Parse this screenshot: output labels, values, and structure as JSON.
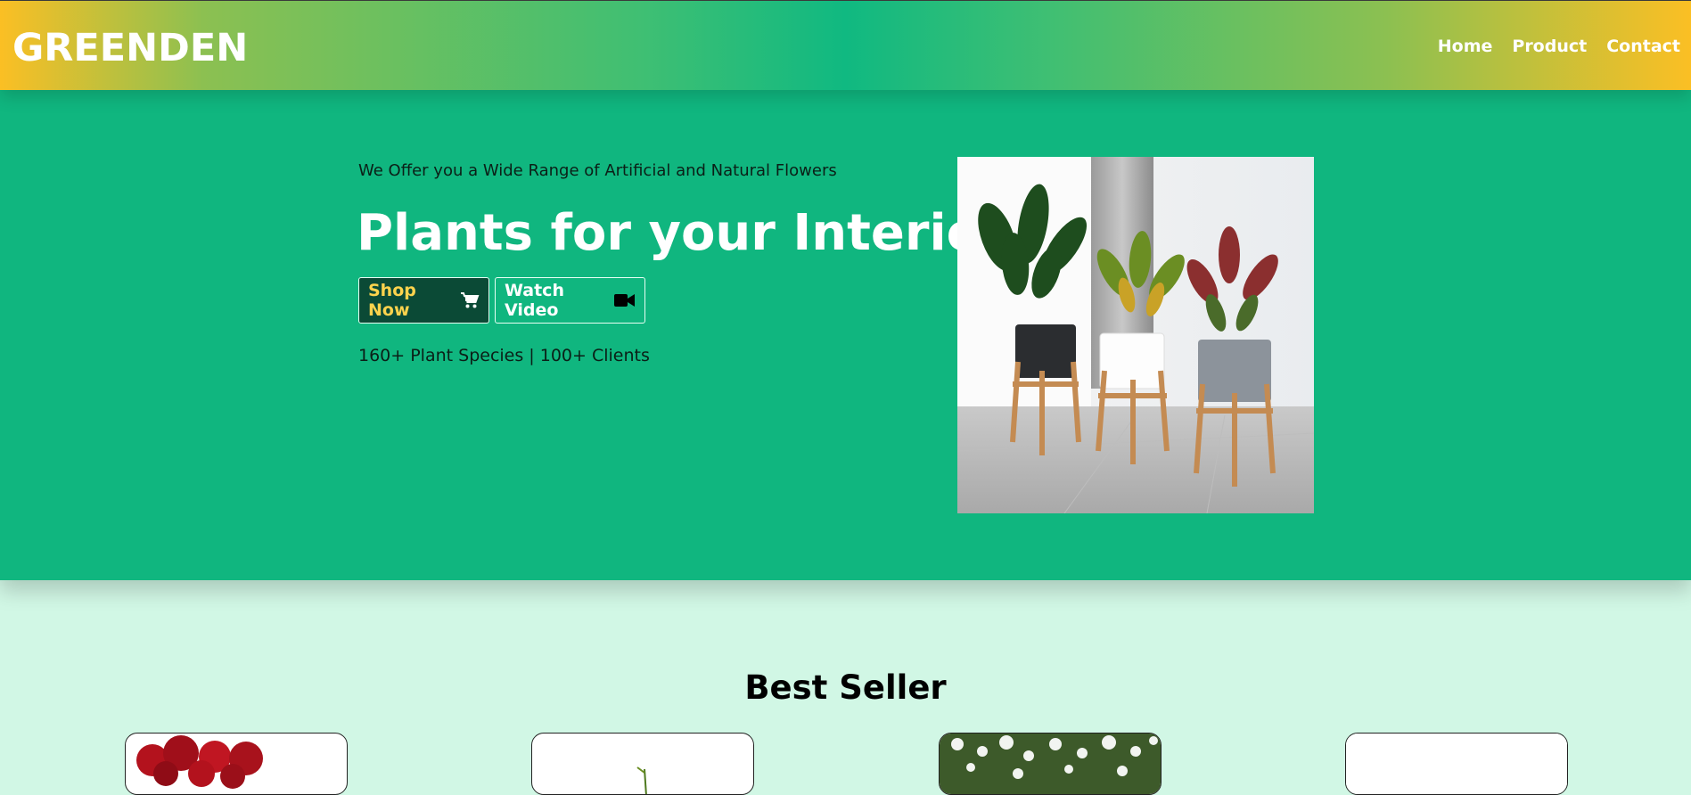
{
  "navbar": {
    "brand": "GREENDEN",
    "links": [
      "Home",
      "Product",
      "Contact"
    ]
  },
  "hero": {
    "tagline": "We Offer you a Wide Range of Artificial and Natural Flowers",
    "headline": "Plants for your Interior",
    "shop_button": "Shop Now",
    "watch_button": "Watch Video",
    "stats": "160+ Plant Species | 100+ Clients",
    "image_icon": "potted-plants-photo"
  },
  "best_seller": {
    "title": "Best Seller",
    "cards": [
      {
        "image_icon": "red-roses-photo"
      },
      {
        "image_icon": "plant-stem-photo"
      },
      {
        "image_icon": "white-flowers-photo"
      },
      {
        "image_icon": "blank-product-photo"
      }
    ]
  },
  "colors": {
    "hero_bg": "#10b67f",
    "section_bg": "#d1f7e5",
    "accent_yellow": "#fbbf24",
    "shop_button_bg": "#0b4a36"
  }
}
